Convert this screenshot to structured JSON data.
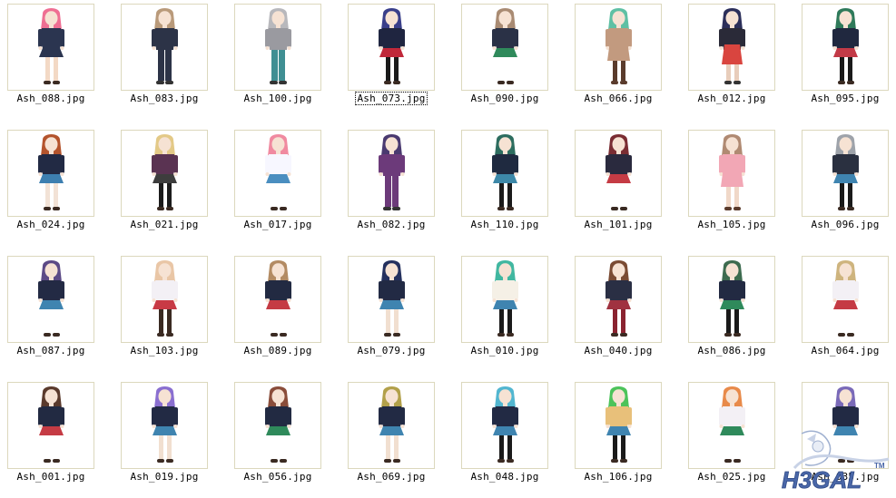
{
  "files": [
    {
      "name": "Ash_088.jpg",
      "hair": "#ef6f93",
      "top": "#2b3550",
      "bottom": "#2b3550",
      "legs": "#f3d9c5",
      "pose": "skirt"
    },
    {
      "name": "Ash_083.jpg",
      "hair": "#b99a7a",
      "top": "#2c3347",
      "bottom": "#2c3347",
      "legs": "#2c3347",
      "pose": "pants"
    },
    {
      "name": "Ash_100.jpg",
      "hair": "#b8b8bc",
      "top": "#9a9aa0",
      "bottom": "#3f8f93",
      "legs": "#3f8f93",
      "pose": "pants"
    },
    {
      "name": "Ash_073.jpg",
      "hair": "#3a3f8a",
      "top": "#1f2540",
      "bottom": "#c0283a",
      "legs": "#1a1a1a",
      "pose": "skirt"
    },
    {
      "name": "Ash_090.jpg",
      "hair": "#a98b73",
      "top": "#2a3146",
      "bottom": "#2f8a5b",
      "legs": "#ffffff",
      "pose": "skirt"
    },
    {
      "name": "Ash_066.jpg",
      "hair": "#5fc0a4",
      "top": "#c29a7f",
      "bottom": "#c29a7f",
      "legs": "#5a3b2c",
      "pose": "dress"
    },
    {
      "name": "Ash_012.jpg",
      "hair": "#2c2f5a",
      "top": "#2a2a38",
      "bottom": "#d9453f",
      "legs": "#e8cdbb",
      "pose": "apron"
    },
    {
      "name": "Ash_095.jpg",
      "hair": "#2f7a5a",
      "top": "#20283f",
      "bottom": "#c23a47",
      "legs": "#1a1a1a",
      "pose": "skirt"
    },
    {
      "name": "Ash_024.jpg",
      "hair": "#b4542d",
      "top": "#222a44",
      "bottom": "#3d7fb0",
      "legs": "#f2e2d6",
      "pose": "skirt"
    },
    {
      "name": "Ash_021.jpg",
      "hair": "#e3c987",
      "top": "#5a3352",
      "bottom": "#3d3d3d",
      "legs": "#1c1c1c",
      "pose": "skirt"
    },
    {
      "name": "Ash_017.jpg",
      "hair": "#f08aa0",
      "top": "#f7f7ff",
      "bottom": "#4a8ec0",
      "legs": "#ffffff",
      "pose": "skirt"
    },
    {
      "name": "Ash_082.jpg",
      "hair": "#4a3a70",
      "top": "#6c3a7a",
      "bottom": "#6c3a7a",
      "legs": "#6c3a7a",
      "pose": "pants"
    },
    {
      "name": "Ash_110.jpg",
      "hair": "#2d6d5f",
      "top": "#1f2a40",
      "bottom": "#3d88a8",
      "legs": "#1a1a1a",
      "pose": "skirt"
    },
    {
      "name": "Ash_101.jpg",
      "hair": "#7a2d33",
      "top": "#2a2a3e",
      "bottom": "#c53b44",
      "legs": "#ffffff",
      "pose": "skirt"
    },
    {
      "name": "Ash_105.jpg",
      "hair": "#b08a72",
      "top": "#f2a7b5",
      "bottom": "#f2a7b5",
      "legs": "#f0d8c8",
      "pose": "dress"
    },
    {
      "name": "Ash_096.jpg",
      "hair": "#9ea3aa",
      "top": "#2a3040",
      "bottom": "#3f84b0",
      "legs": "#1a1a1a",
      "pose": "skirt"
    },
    {
      "name": "Ash_087.jpg",
      "hair": "#5c4a86",
      "top": "#232a44",
      "bottom": "#3f84b0",
      "legs": "#ffffff",
      "pose": "skirt"
    },
    {
      "name": "Ash_103.jpg",
      "hair": "#e9c6a6",
      "top": "#f3f0f5",
      "bottom": "#c83a45",
      "legs": "#3a2a22",
      "pose": "skirt"
    },
    {
      "name": "Ash_089.jpg",
      "hair": "#b38b63",
      "top": "#222a42",
      "bottom": "#c53b44",
      "legs": "#ffffff",
      "pose": "skirt"
    },
    {
      "name": "Ash_079.jpg",
      "hair": "#24305e",
      "top": "#222a44",
      "bottom": "#3f84b0",
      "legs": "#f1dfd0",
      "pose": "skirt"
    },
    {
      "name": "Ash_010.jpg",
      "hair": "#41b7a0",
      "top": "#f5f0e6",
      "bottom": "#3f84b0",
      "legs": "#1a1a1a",
      "pose": "skirt"
    },
    {
      "name": "Ash_040.jpg",
      "hair": "#7a4b33",
      "top": "#2a2f44",
      "bottom": "#a03240",
      "legs": "#8a2330",
      "pose": "skirt"
    },
    {
      "name": "Ash_086.jpg",
      "hair": "#3d6b4f",
      "top": "#222a42",
      "bottom": "#2f8a5b",
      "legs": "#1a1a1a",
      "pose": "skirt"
    },
    {
      "name": "Ash_064.jpg",
      "hair": "#ceb47e",
      "top": "#f3f0f5",
      "bottom": "#c53b44",
      "legs": "#ffffff",
      "pose": "skirt"
    },
    {
      "name": "Ash_001.jpg",
      "hair": "#5a3a2c",
      "top": "#222a42",
      "bottom": "#c53b44",
      "legs": "#ffffff",
      "pose": "skirt"
    },
    {
      "name": "Ash_019.jpg",
      "hair": "#8a6fd0",
      "top": "#222a44",
      "bottom": "#3f84b0",
      "legs": "#f1dfd0",
      "pose": "skirt"
    },
    {
      "name": "Ash_056.jpg",
      "hair": "#8a4d3a",
      "top": "#222a42",
      "bottom": "#2f8a5b",
      "legs": "#ffffff",
      "pose": "skirt"
    },
    {
      "name": "Ash_069.jpg",
      "hair": "#b2a04a",
      "top": "#222a44",
      "bottom": "#3f84b0",
      "legs": "#f1dfd0",
      "pose": "skirt"
    },
    {
      "name": "Ash_048.jpg",
      "hair": "#52b6d0",
      "top": "#222a44",
      "bottom": "#3f84b0",
      "legs": "#1a1a1a",
      "pose": "skirt"
    },
    {
      "name": "Ash_106.jpg",
      "hair": "#4cc35a",
      "top": "#e8c07a",
      "bottom": "#3f84b0",
      "legs": "#1a1a1a",
      "pose": "skirt"
    },
    {
      "name": "Ash_025.jpg",
      "hair": "#e88a4a",
      "top": "#f3f0f5",
      "bottom": "#2f8a5b",
      "legs": "#ffffff",
      "pose": "skirt"
    },
    {
      "name": "Ash_035.jpg",
      "hair": "#7a6ab8",
      "top": "#222a44",
      "bottom": "#3f84b0",
      "legs": "#ffffff",
      "pose": "skirt"
    }
  ],
  "focused_file": "Ash_073.jpg",
  "watermark": {
    "text": "H3GAL",
    "mark": "TM",
    "color": "#4a67a8",
    "accent": "#8fa4cc"
  }
}
